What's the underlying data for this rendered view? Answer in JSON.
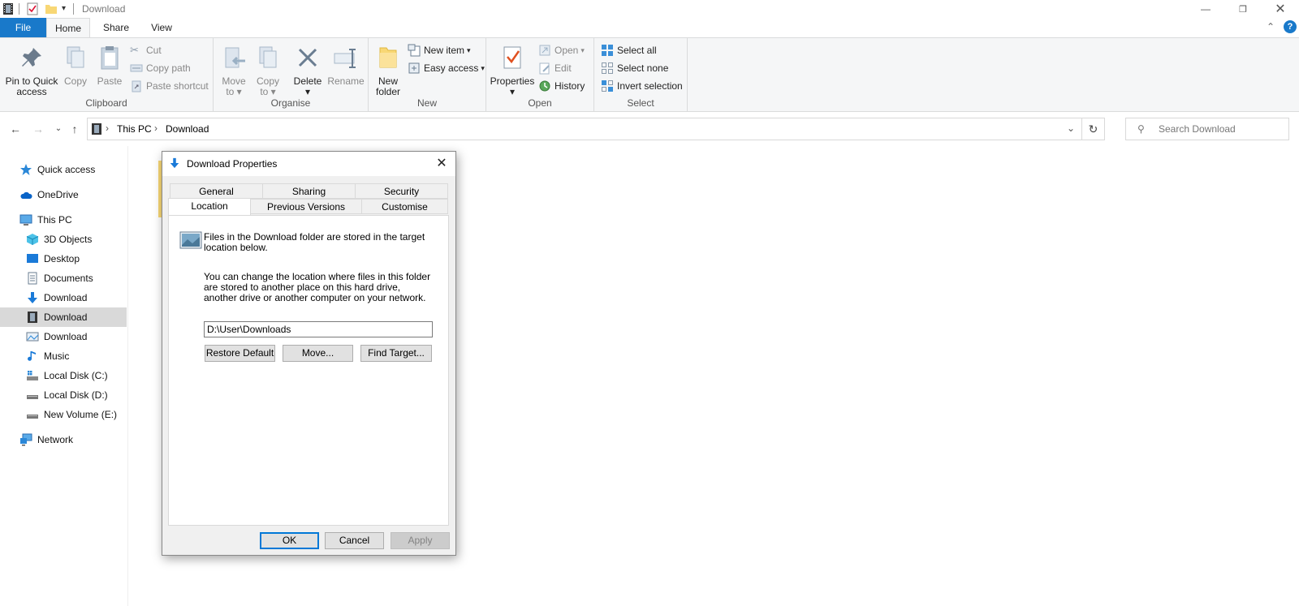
{
  "window": {
    "title": "Download"
  },
  "ribbon_tabs": [
    "File",
    "Home",
    "Share",
    "View"
  ],
  "ribbon": {
    "clipboard": {
      "label": "Clipboard",
      "pin": [
        "Pin to Quick",
        "access"
      ],
      "copy": "Copy",
      "paste": "Paste",
      "cut": "Cut",
      "copy_path": "Copy path",
      "paste_shortcut": "Paste shortcut"
    },
    "organise": {
      "label": "Organise",
      "move_to": [
        "Move",
        "to"
      ],
      "copy_to": [
        "Copy",
        "to"
      ],
      "delete": "Delete",
      "rename": "Rename"
    },
    "new": {
      "label": "New",
      "new_folder": [
        "New",
        "folder"
      ],
      "new_item": "New item",
      "easy_access": "Easy access"
    },
    "open": {
      "label": "Open",
      "properties": "Properties",
      "open": "Open",
      "edit": "Edit",
      "history": "History"
    },
    "select": {
      "label": "Select",
      "select_all": "Select all",
      "select_none": "Select none",
      "invert": "Invert selection"
    }
  },
  "address": {
    "crumbs": [
      "This PC",
      "Download"
    ],
    "search_placeholder": "Search Download"
  },
  "nav": {
    "items": [
      {
        "label": "Quick access",
        "icon": "star-icon"
      },
      {
        "label": "OneDrive",
        "icon": "cloud-icon"
      },
      {
        "label": "This PC",
        "icon": "computer-icon"
      },
      {
        "label": "3D Objects",
        "icon": "cube-icon"
      },
      {
        "label": "Desktop",
        "icon": "desktop-icon"
      },
      {
        "label": "Documents",
        "icon": "document-icon"
      },
      {
        "label": "Download",
        "icon": "download-arrow-icon"
      },
      {
        "label": "Download",
        "icon": "film-icon"
      },
      {
        "label": "Download",
        "icon": "picture-icon"
      },
      {
        "label": "Music",
        "icon": "music-note-icon"
      },
      {
        "label": "Local Disk (C:)",
        "icon": "drive-icon"
      },
      {
        "label": "Local Disk (D:)",
        "icon": "drive-icon"
      },
      {
        "label": "New Volume (E:)",
        "icon": "drive-icon"
      },
      {
        "label": "Network",
        "icon": "network-icon"
      }
    ]
  },
  "dialog": {
    "title": "Download Properties",
    "tabs_row1": [
      "General",
      "Sharing",
      "Security"
    ],
    "tabs_row2": [
      "Location",
      "Previous Versions",
      "Customise"
    ],
    "active_tab": "Location",
    "text1": "Files in the Download folder are stored in the target location below.",
    "text2": "You can change the location where files in this folder are stored to another place on this hard drive, another drive or another computer on your network.",
    "path_value": "D:\\User\\Downloads",
    "restore_default": "Restore Default",
    "move": "Move...",
    "find_target": "Find Target...",
    "ok": "OK",
    "cancel": "Cancel",
    "apply": "Apply"
  },
  "colors": {
    "file_tab": "#1979ca",
    "selection": "#d9d9d9",
    "focus_border": "#0078d7"
  }
}
